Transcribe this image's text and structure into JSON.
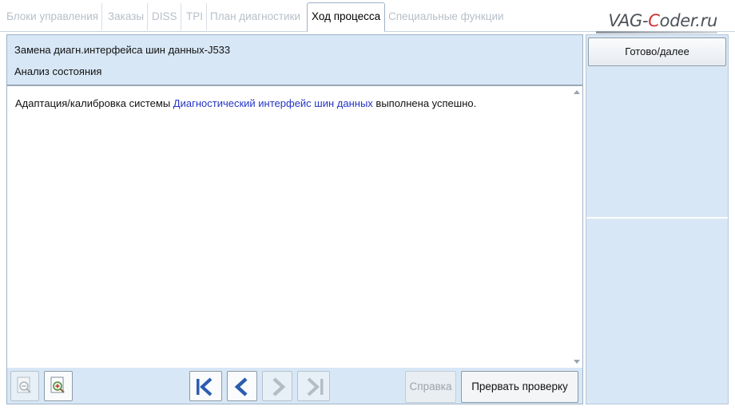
{
  "tabs": [
    {
      "label": "Блоки управления"
    },
    {
      "label": "Заказы"
    },
    {
      "label": "DISS"
    },
    {
      "label": "TPI"
    },
    {
      "label": "План диагностики"
    },
    {
      "label": "Ход процесса"
    },
    {
      "label": "Специальные функции"
    }
  ],
  "active_tab": "Ход процесса",
  "watermark": {
    "prefix": "VAG-",
    "accent": "C",
    "suffix": "oder.ru"
  },
  "header": {
    "title": "Замена диагн.интерфейса шин данных-J533",
    "subtitle": "Анализ состояния"
  },
  "message": {
    "before": "Адаптация/калибровка системы ",
    "link": "Диагностический интерфейс шин данных",
    "after": " выполнена успешно."
  },
  "buttons": {
    "help": "Справка",
    "abort": "Прервать проверку",
    "done": "Готово/далее"
  },
  "icons": [
    "zoom-out-icon",
    "zoom-in-icon",
    "first-step-icon",
    "previous-step-icon",
    "next-step-icon",
    "last-step-icon"
  ],
  "colors": {
    "panel_bg": "#d8e7f6",
    "link": "#2436c4",
    "nav_accent": "#2a5db0",
    "disabled": "#b7bfc8"
  }
}
